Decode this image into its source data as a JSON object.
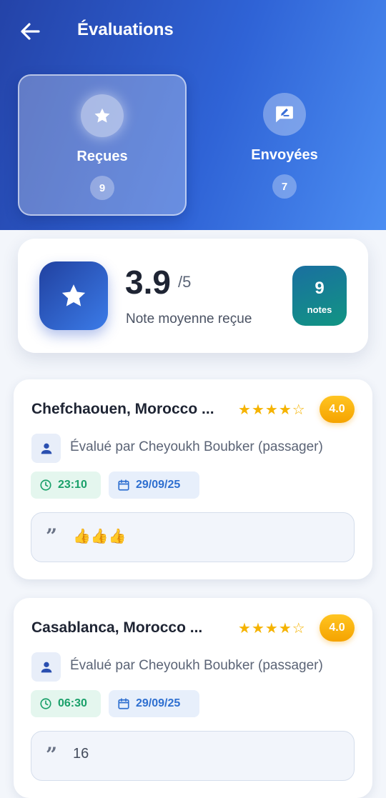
{
  "header": {
    "title": "Évaluations",
    "back_icon": "arrow-left-icon"
  },
  "tabs": [
    {
      "label": "Reçues",
      "count": "9",
      "icon": "star-icon",
      "active": true
    },
    {
      "label": "Envoyées",
      "count": "7",
      "icon": "rate-review-icon",
      "active": false
    }
  ],
  "summary": {
    "average": "3.9",
    "max": "/5",
    "label": "Note moyenne reçue",
    "notes_count": "9",
    "notes_label": "notes"
  },
  "reviews": [
    {
      "title": "Chefchaouen, Morocco ...",
      "stars_filled": 4,
      "stars_total": 5,
      "rating": "4.0",
      "evaluator": "Évalué par Cheyoukh Boubker (passager)",
      "time": "23:10",
      "date": "29/09/25",
      "comment": "👍👍👍"
    },
    {
      "title": "Casablanca, Morocco ...",
      "stars_filled": 4,
      "stars_total": 5,
      "rating": "4.0",
      "evaluator": "Évalué par Cheyoukh Boubker (passager)",
      "time": "06:30",
      "date": "29/09/25",
      "comment": "16"
    }
  ],
  "colors": {
    "header_gradient_start": "#2443a8",
    "header_gradient_end": "#4c8ef2",
    "rating_badge": "#f5a300",
    "star": "#f5b301",
    "time_chip_text": "#1aa06a",
    "date_chip_text": "#2e6fd0"
  }
}
